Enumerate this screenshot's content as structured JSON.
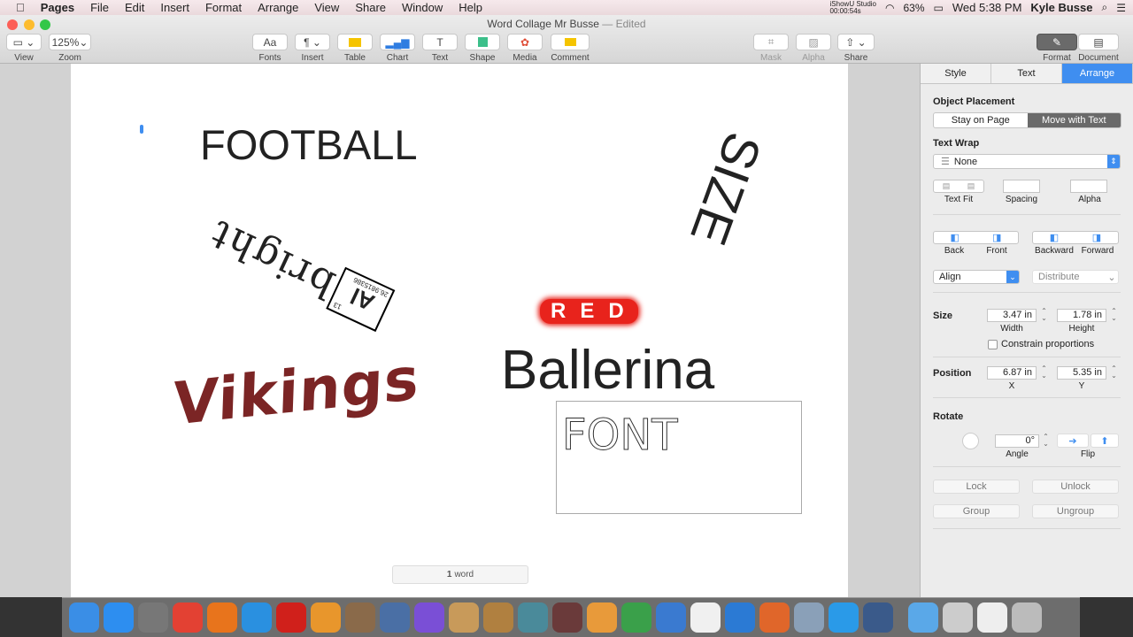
{
  "menubar": {
    "apple": "",
    "app": "Pages",
    "items": [
      "File",
      "Edit",
      "Insert",
      "Format",
      "Arrange",
      "View",
      "Share",
      "Window",
      "Help"
    ],
    "recorder": "iShowU Studio",
    "recorder_time": "00:00:54s",
    "battery": "63%",
    "clock": "Wed 5:38 PM",
    "user": "Kyle Busse"
  },
  "window": {
    "title": "Word Collage Mr Busse",
    "edited": "— Edited"
  },
  "toolbar": {
    "view": "View",
    "zoom_value": "125%",
    "zoom": "Zoom",
    "fonts": "Fonts",
    "fonts_glyph": "Aa",
    "insert": "Insert",
    "table": "Table",
    "chart": "Chart",
    "text": "Text",
    "text_glyph": "T",
    "shape": "Shape",
    "media": "Media",
    "comment": "Comment",
    "mask": "Mask",
    "alpha": "Alpha",
    "share": "Share",
    "format": "Format",
    "document": "Document"
  },
  "canvas": {
    "words": {
      "football": "FOOTBALL",
      "size": "SIZE",
      "albright": "bright",
      "element_symbol": "Al",
      "element_number": "13",
      "element_mass": "26.9815386",
      "vikings": "Vikings",
      "red": "RED",
      "ballerina": "Ballerina",
      "font": "FONT"
    },
    "word_count_num": "1",
    "word_count_label": "word"
  },
  "sidebar": {
    "tabs": [
      "Style",
      "Text",
      "Arrange"
    ],
    "active_tab": "Arrange",
    "object_placement": "Object Placement",
    "stay_on_page": "Stay on Page",
    "move_with_text": "Move with Text",
    "text_wrap": "Text Wrap",
    "wrap_value": "None",
    "text_fit": "Text Fit",
    "spacing": "Spacing",
    "alpha": "Alpha",
    "back": "Back",
    "front": "Front",
    "backward": "Backward",
    "forward": "Forward",
    "align": "Align",
    "distribute": "Distribute",
    "size": "Size",
    "width": "3.47 in",
    "width_label": "Width",
    "height": "1.78 in",
    "height_label": "Height",
    "constrain": "Constrain proportions",
    "constrain_checked": false,
    "position": "Position",
    "x": "6.87 in",
    "x_label": "X",
    "y": "5.35 in",
    "y_label": "Y",
    "rotate": "Rotate",
    "angle": "0°",
    "angle_label": "Angle",
    "flip": "Flip",
    "lock": "Lock",
    "unlock": "Unlock",
    "group": "Group",
    "ungroup": "Ungroup"
  },
  "colors": {
    "accent": "#3f8ef0",
    "vikings": "#7b2525",
    "red": "#e8231c"
  },
  "dock": [
    "finder",
    "app-store",
    "launchpad",
    "chrome",
    "firefox",
    "safari",
    "opera",
    "scratch",
    "garageband",
    "imovie-trailer",
    "imovie",
    "iphoto",
    "pen-tool",
    "image-capture",
    "photo-booth",
    "pages",
    "numbers",
    "keynote",
    "itunes",
    "word",
    "powerpoint",
    "preview",
    "twitter",
    "quicktime",
    "downloads",
    "jhlp",
    "documents",
    "trash"
  ]
}
